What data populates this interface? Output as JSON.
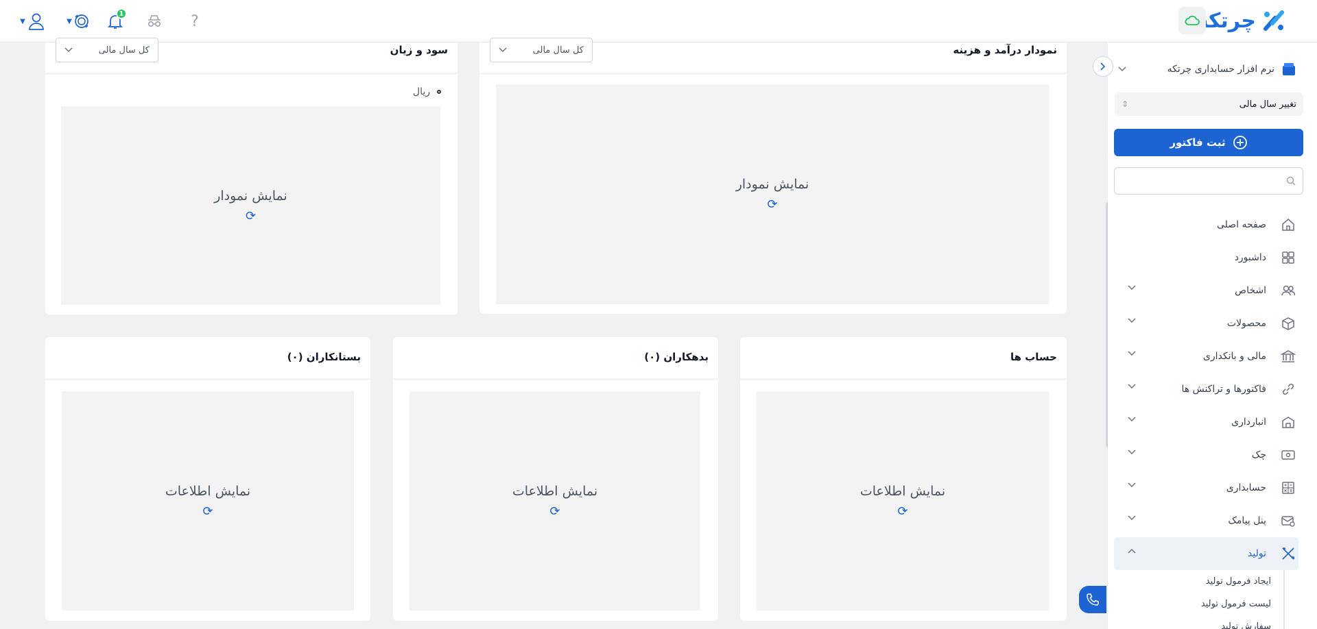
{
  "header": {
    "brand_name": "چرتکه",
    "notification_count": "1"
  },
  "sidebar": {
    "company_name": "نرم افزار حسابداری چرتکه",
    "fiscal_year_button": "تغییر سال مالی",
    "new_invoice_button": "ثبت فاکتور",
    "search_placeholder": "",
    "menu": [
      {
        "label": "صفحه اصلی",
        "icon": "home-icon"
      },
      {
        "label": "داشبورد",
        "icon": "dashboard-icon"
      },
      {
        "label": "اشخاص",
        "icon": "people-icon"
      },
      {
        "label": "محصولات",
        "icon": "box-icon"
      },
      {
        "label": "مالی و بانکداری",
        "icon": "bank-icon"
      },
      {
        "label": "فاکتورها و تراکنش ها",
        "icon": "link-icon"
      },
      {
        "label": "انبارداری",
        "icon": "warehouse-icon"
      },
      {
        "label": "چک",
        "icon": "cheque-icon"
      },
      {
        "label": "حسابداری",
        "icon": "calculator-icon"
      },
      {
        "label": "پنل پیامک",
        "icon": "sms-icon"
      },
      {
        "label": "تولید",
        "icon": "tools-icon"
      }
    ],
    "submenu": [
      "ایجاد فرمول تولید",
      "لیست فرمول تولید",
      "سفارش تولید"
    ]
  },
  "cards": {
    "income_expense": {
      "title": "نمودار درآمد و هزینه",
      "select": "کل سال مالی",
      "placeholder": "نمایش نمودار"
    },
    "profit_loss": {
      "title": "سود و زیان",
      "select": "کل سال مالی",
      "placeholder": "نمایش نمودار",
      "legend": "ریال"
    },
    "accounts": {
      "title": "حساب ها",
      "placeholder": "نمایش اطلاعات"
    },
    "debtors": {
      "title": "بدهکاران (۰)",
      "placeholder": "نمایش اطلاعات"
    },
    "creditors": {
      "title": "بستانکاران (۰)",
      "placeholder": "نمایش اطلاعات"
    }
  },
  "colors": {
    "accent": "#1d63d1",
    "badge": "#22c55e"
  }
}
